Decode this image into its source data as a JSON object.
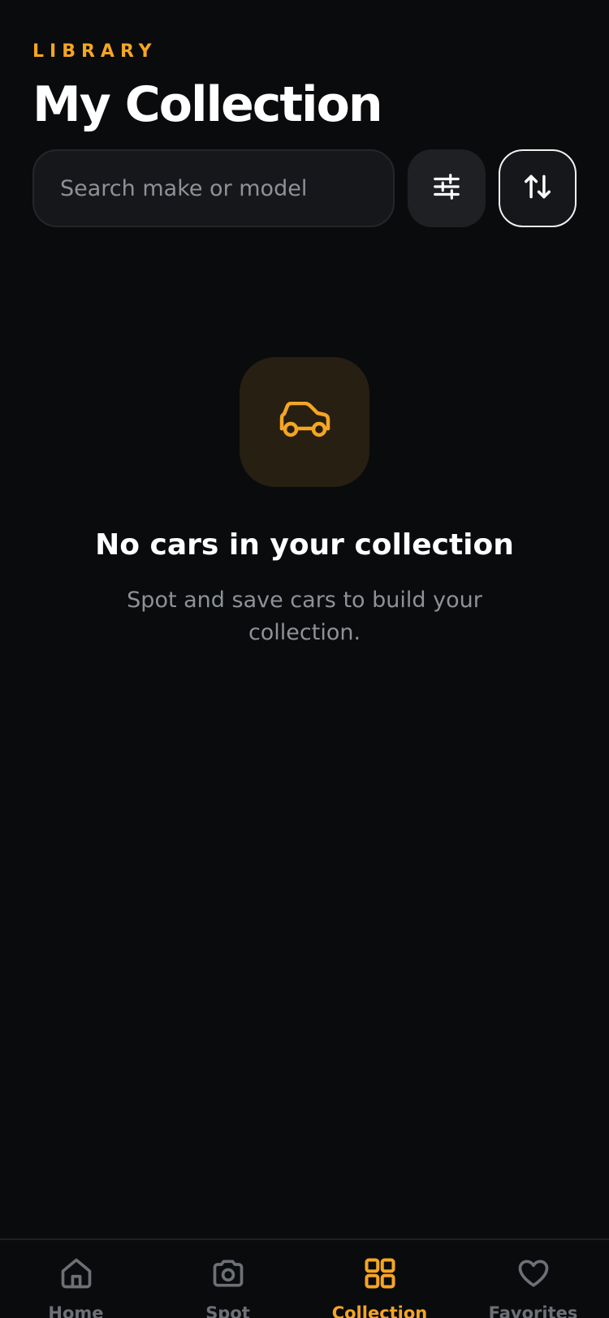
{
  "header": {
    "eyebrow": "LIBRARY",
    "title": "My Collection"
  },
  "search": {
    "placeholder": "Search make or model",
    "value": ""
  },
  "toolbar": {
    "filter_icon": "sliders-icon",
    "sort_icon": "sort-arrows-icon"
  },
  "empty_state": {
    "icon": "car-icon",
    "title": "No cars in your collection",
    "subtitle": "Spot and save cars to build your collection."
  },
  "tabbar": {
    "active": "Collection",
    "items": [
      {
        "label": "Home",
        "icon": "home-icon"
      },
      {
        "label": "Spot",
        "icon": "camera-icon"
      },
      {
        "label": "Collection",
        "icon": "grid-icon"
      },
      {
        "label": "Favorites",
        "icon": "heart-icon"
      }
    ]
  },
  "colors": {
    "background": "#0a0b0d",
    "accent": "#f5a524",
    "muted_text": "#8e9197",
    "inactive_tab": "#6d7076"
  }
}
